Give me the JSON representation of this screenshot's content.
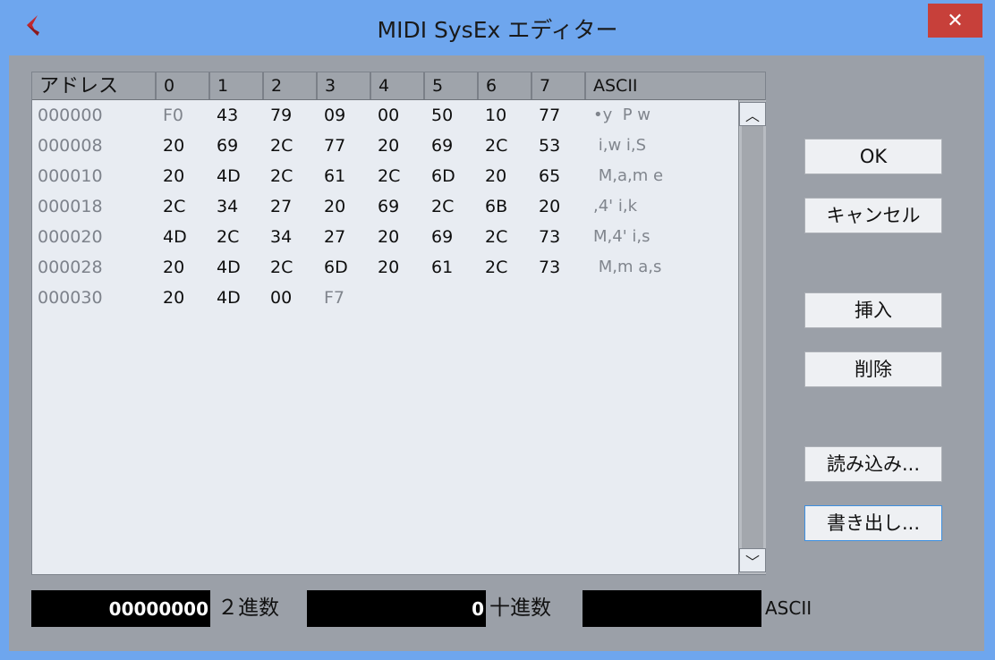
{
  "window": {
    "title": "MIDI SysEx エディター",
    "close_glyph": "✕"
  },
  "grid": {
    "headers": [
      "アドレス",
      "0",
      "1",
      "2",
      "3",
      "4",
      "5",
      "6",
      "7",
      "ASCII"
    ],
    "rows": [
      {
        "addr": "000000",
        "bytes": [
          "F0",
          "43",
          "79",
          "09",
          "00",
          "50",
          "10",
          "77"
        ],
        "ascii": "•y  P w"
      },
      {
        "addr": "000008",
        "bytes": [
          "20",
          "69",
          "2C",
          "77",
          "20",
          "69",
          "2C",
          "53"
        ],
        "ascii": " i,w i,S"
      },
      {
        "addr": "000010",
        "bytes": [
          "20",
          "4D",
          "2C",
          "61",
          "2C",
          "6D",
          "20",
          "65"
        ],
        "ascii": " M,a,m e"
      },
      {
        "addr": "000018",
        "bytes": [
          "2C",
          "34",
          "27",
          "20",
          "69",
          "2C",
          "6B",
          "20"
        ],
        "ascii": ",4' i,k"
      },
      {
        "addr": "000020",
        "bytes": [
          "4D",
          "2C",
          "34",
          "27",
          "20",
          "69",
          "2C",
          "73"
        ],
        "ascii": "M,4' i,s"
      },
      {
        "addr": "000028",
        "bytes": [
          "20",
          "4D",
          "2C",
          "6D",
          "20",
          "61",
          "2C",
          "73"
        ],
        "ascii": " M,m a,s"
      },
      {
        "addr": "000030",
        "bytes": [
          "20",
          "4D",
          "00",
          "F7"
        ],
        "ascii": ""
      }
    ],
    "scroll_up_glyph": "︿",
    "scroll_down_glyph": "﹀"
  },
  "buttons": {
    "ok": "OK",
    "cancel": "キャンセル",
    "insert": "挿入",
    "delete": "削除",
    "load": "読み込み...",
    "save": "書き出し..."
  },
  "status": {
    "binary_value": "00000000",
    "binary_label": "２進数",
    "decimal_value": "0",
    "decimal_label": "十進数",
    "ascii_value": "",
    "ascii_label": "ASCII"
  },
  "colors": {
    "title_bar": "#6ea6ee",
    "close": "#c7403a",
    "dialog_bg": "#9ba0a8",
    "grid_bg": "#e8ecf2",
    "app_icon": "#c0282e"
  }
}
